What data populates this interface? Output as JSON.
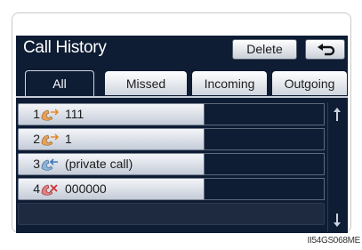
{
  "header": {
    "title": "Call History",
    "delete_label": "Delete",
    "back_icon": "back-arrow-icon"
  },
  "tabs": [
    {
      "label": "All",
      "active": true
    },
    {
      "label": "Missed",
      "active": false
    },
    {
      "label": "Incoming",
      "active": false
    },
    {
      "label": "Outgoing",
      "active": false
    }
  ],
  "calls": [
    {
      "index": "1",
      "type": "outgoing",
      "icon": "outgoing-call-icon",
      "name": "111"
    },
    {
      "index": "2",
      "type": "outgoing",
      "icon": "outgoing-call-icon",
      "name": "1"
    },
    {
      "index": "3",
      "type": "incoming",
      "icon": "incoming-call-icon",
      "name": "(private call)"
    },
    {
      "index": "4",
      "type": "missed",
      "icon": "missed-call-icon",
      "name": "000000"
    }
  ],
  "scrollbar": {
    "up_icon": "scroll-up-icon",
    "down_icon": "scroll-down-icon"
  },
  "caption": "II54GS068ME",
  "colors": {
    "screen_bg": "#0e1c34",
    "row_light": "#f3f5f8",
    "missed_accent": "#d23030"
  }
}
